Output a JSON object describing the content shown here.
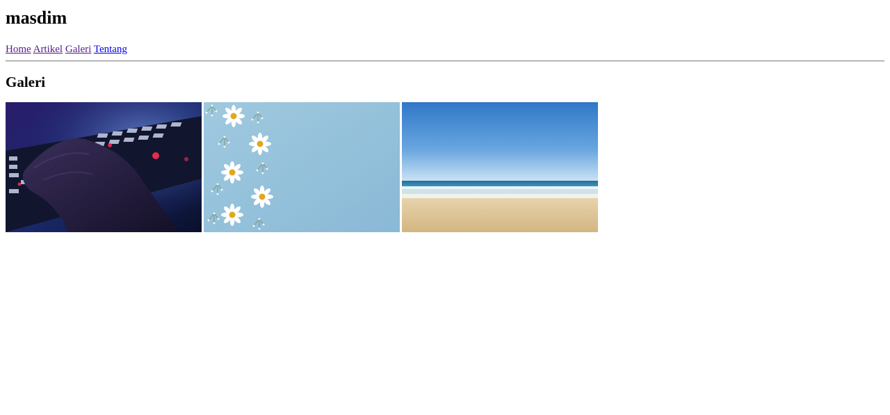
{
  "site": {
    "title": "masdim"
  },
  "nav": {
    "items": [
      {
        "label": "Home",
        "state": "visited"
      },
      {
        "label": "Artikel",
        "state": "visited"
      },
      {
        "label": "Galeri",
        "state": "visited"
      },
      {
        "label": "Tentang",
        "state": "unvisited"
      }
    ]
  },
  "section": {
    "title": "Galeri"
  },
  "gallery": {
    "images": [
      {
        "subject": "hand on illuminated gaming keyboard"
      },
      {
        "subject": "white daisies on light blue background"
      },
      {
        "subject": "blue sky over sea and sandy beach"
      }
    ]
  },
  "colors": {
    "link_visited": "#551a8b",
    "link_unvisited": "#0000ee"
  }
}
